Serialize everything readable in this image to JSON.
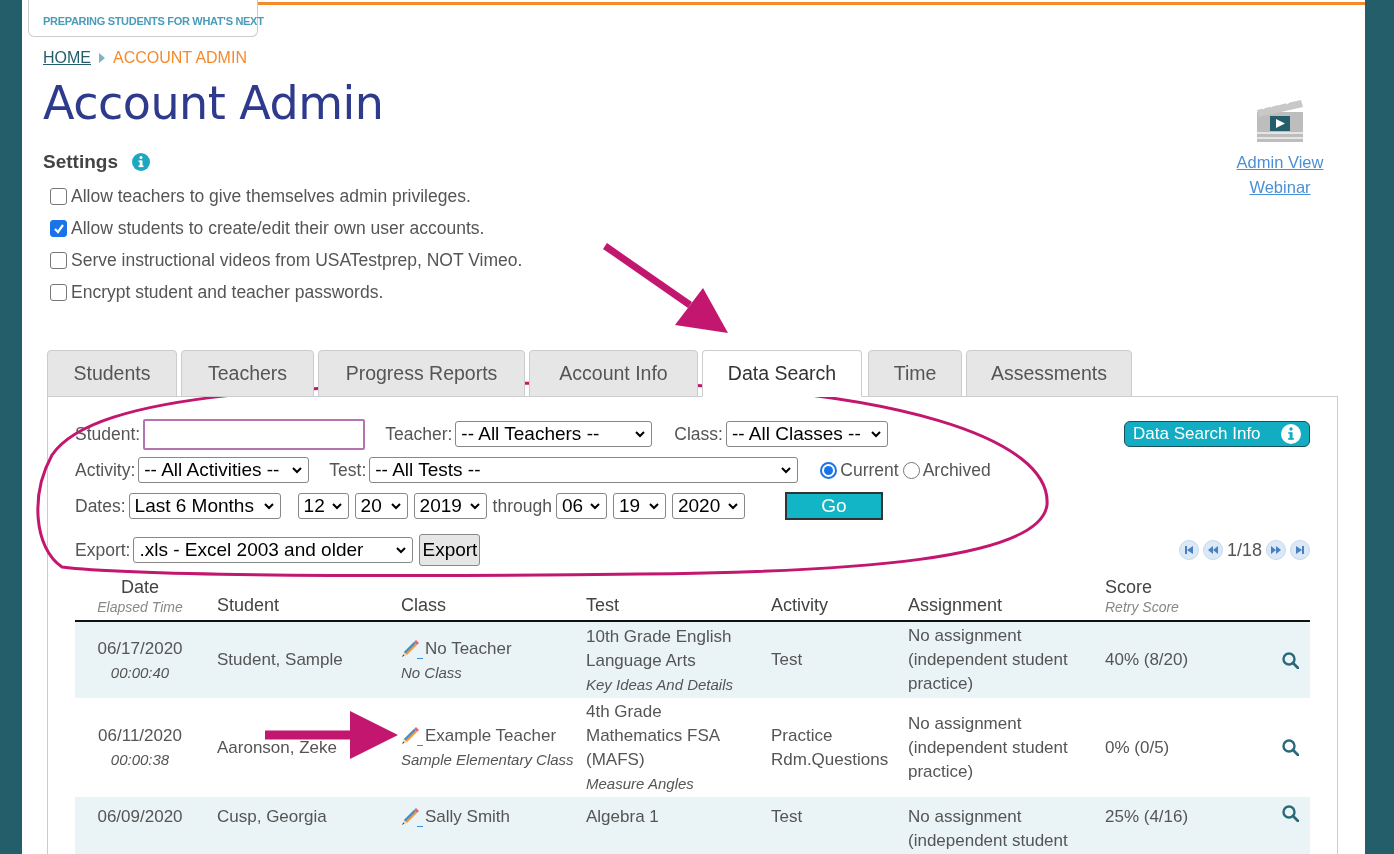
{
  "logo": {
    "tagline": "PREPARING STUDENTS FOR WHAT'S NEXT"
  },
  "breadcrumb": [
    {
      "label": "HOME",
      "kind": "link"
    },
    {
      "label": "ACCOUNT ADMIN",
      "kind": "current"
    }
  ],
  "title": "Account Admin",
  "settings": {
    "heading": "Settings",
    "options": [
      {
        "label": "Allow teachers to give themselves admin privileges.",
        "checked": false
      },
      {
        "label": "Allow students to create/edit their own user accounts.",
        "checked": true
      },
      {
        "label": "Serve instructional videos from USATestprep, NOT Vimeo.",
        "checked": false
      },
      {
        "label": "Encrypt student and teacher passwords.",
        "checked": false
      }
    ]
  },
  "webinar": {
    "label": "Admin View Webinar"
  },
  "tabs": [
    {
      "label": "Students",
      "selected": false
    },
    {
      "label": "Teachers",
      "selected": false
    },
    {
      "label": "Progress Reports",
      "selected": false
    },
    {
      "label": "Account Info",
      "selected": false
    },
    {
      "label": "Data Search",
      "selected": true
    },
    {
      "label": "Time",
      "selected": false
    },
    {
      "label": "Assessments",
      "selected": false
    }
  ],
  "form": {
    "student": {
      "label": "Student:"
    },
    "teacher": {
      "label": "Teacher:",
      "value": "-- All Teachers --"
    },
    "class": {
      "label": "Class:",
      "value": "-- All Classes --"
    },
    "info_button": "Data Search Info",
    "activity": {
      "label": "Activity:",
      "value": "-- All Activities --"
    },
    "test": {
      "label": "Test:",
      "value": "-- All Tests --"
    },
    "scope": [
      {
        "label": "Current",
        "selected": true
      },
      {
        "label": "Archived",
        "selected": false
      }
    ],
    "dates": {
      "label": "Dates:",
      "range": "Last 6 Months",
      "from": [
        "12",
        "20",
        "2019"
      ],
      "through": "through",
      "to": [
        "06",
        "19",
        "2020"
      ]
    },
    "go": "Go",
    "export": {
      "label": "Export:",
      "format": ".xls - Excel 2003 and older",
      "button": "Export"
    },
    "pager": "1/18"
  },
  "table": {
    "columns": [
      {
        "label": "Date",
        "sublabel": "Elapsed Time"
      },
      {
        "label": "Student"
      },
      {
        "label": "Class"
      },
      {
        "label": "Test"
      },
      {
        "label": "Activity"
      },
      {
        "label": "Assignment"
      },
      {
        "label": "Score",
        "sublabel": "Retry Score"
      }
    ],
    "rows": [
      {
        "date": "06/17/2020",
        "elapsed": "00:00:40",
        "student": "Student, Sample",
        "teacher": "No Teacher",
        "class": "No Class",
        "test": "10th Grade English Language Arts",
        "topic": "Key Ideas And Details",
        "activity": "Test",
        "assignment": "No assignment (independent student practice)",
        "score": "40% (8/20)"
      },
      {
        "date": "06/11/2020",
        "elapsed": "00:00:38",
        "student": "Aaronson, Zeke",
        "teacher": "Example Teacher",
        "class": "Sample Elementary Class",
        "test": "4th Grade Mathematics FSA (MAFS)",
        "topic": "Measure Angles",
        "activity": "Practice Rdm.Questions",
        "assignment": "No assignment (independent student practice)",
        "score": "0% (0/5)"
      },
      {
        "date": "06/09/2020",
        "student": "Cusp, Georgia",
        "teacher": "Sally Smith",
        "test": "Algebra 1",
        "activity": "Test",
        "assignment": "No assignment (independent student",
        "score": "25% (4/16)"
      }
    ]
  }
}
